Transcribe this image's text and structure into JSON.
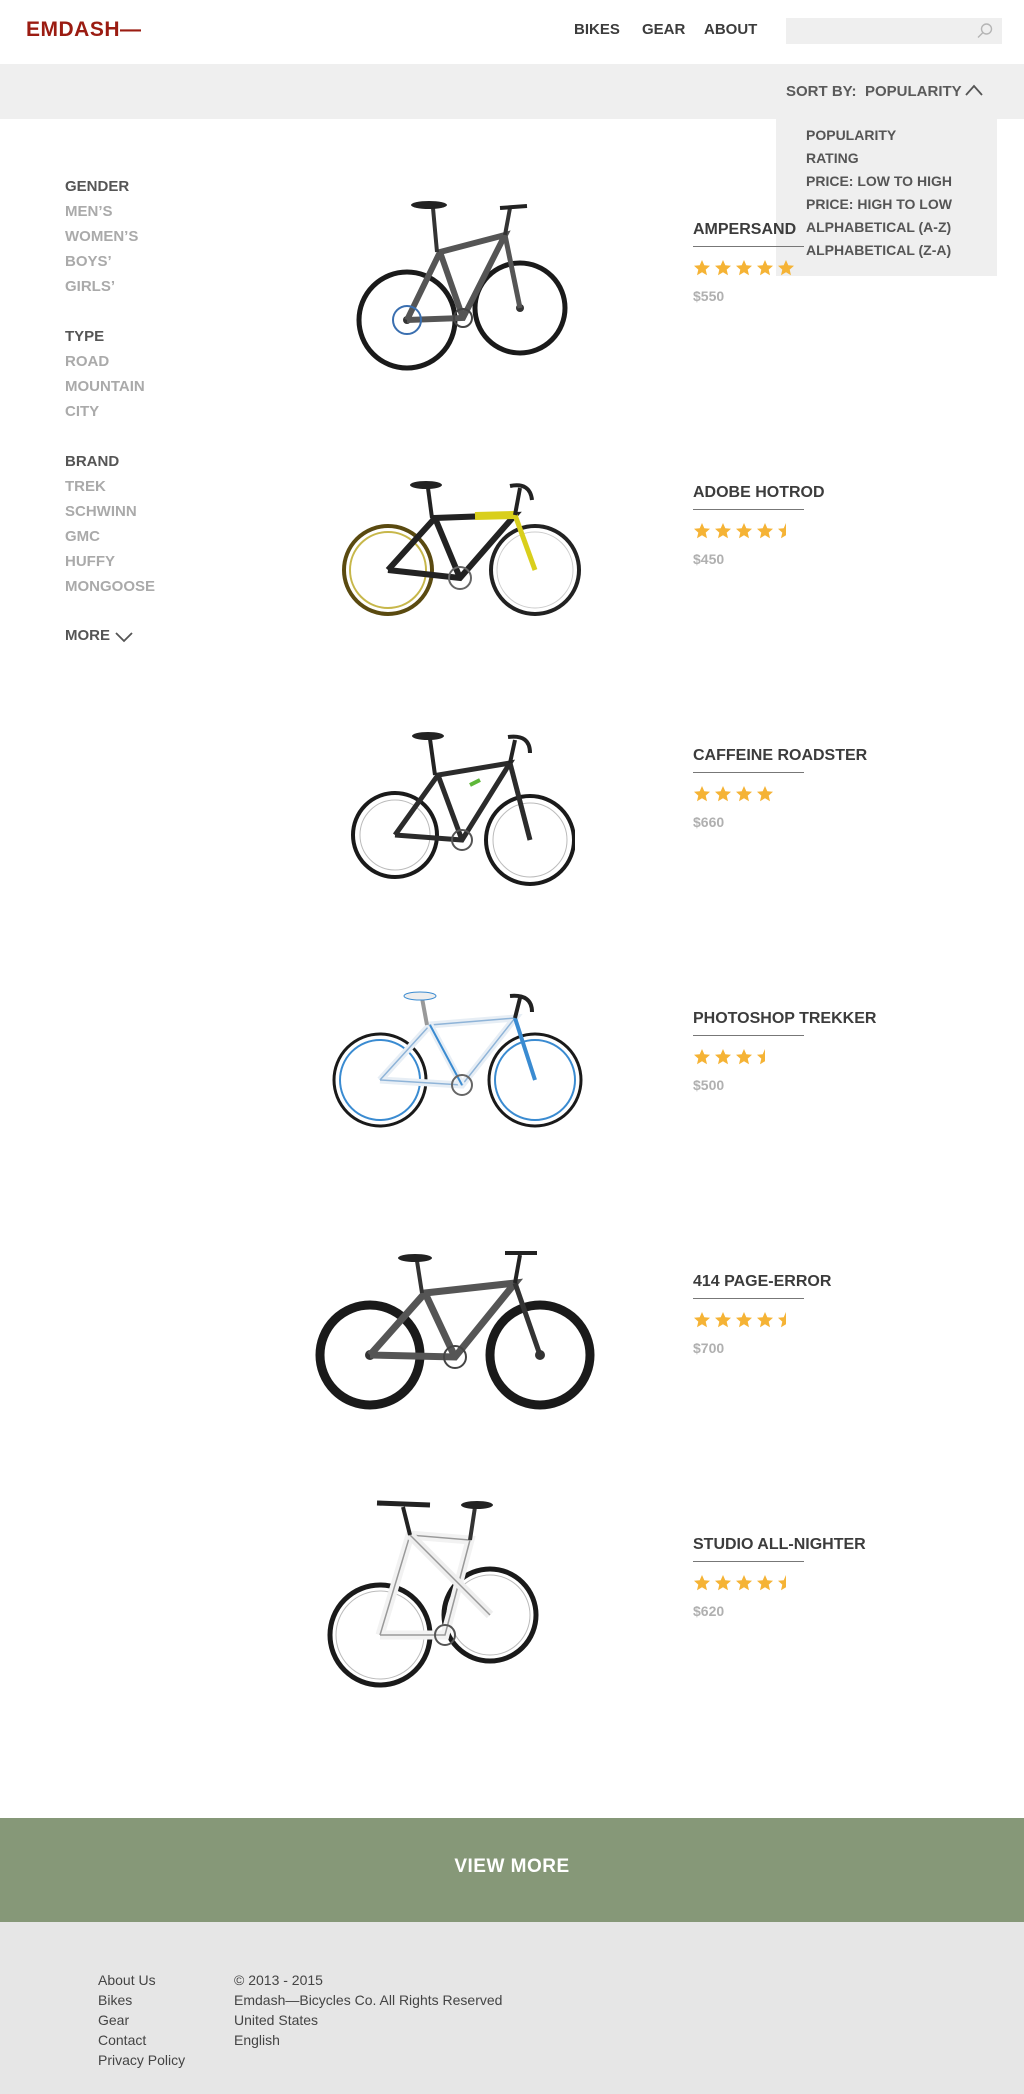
{
  "header": {
    "logo": "EMDASH—",
    "nav": [
      "BIKES",
      "GEAR",
      "ABOUT"
    ],
    "search_placeholder": ""
  },
  "sort": {
    "label": "SORT BY:",
    "value": "POPULARITY",
    "options": [
      "POPULARITY",
      "RATING",
      "PRICE: LOW TO HIGH",
      "PRICE: HIGH TO LOW",
      "ALPHABETICAL (A-Z)",
      "ALPHABETICAL (Z-A)"
    ]
  },
  "filters": {
    "gender": {
      "title": "GENDER",
      "items": [
        "MEN’S",
        "WOMEN’S",
        "BOYS’",
        "GIRLS’"
      ]
    },
    "type": {
      "title": "TYPE",
      "items": [
        "ROAD",
        "MOUNTAIN",
        "CITY"
      ]
    },
    "brand": {
      "title": "BRAND",
      "items": [
        "TREK",
        "SCHWINN",
        "GMC",
        "HUFFY",
        "MONGOOSE"
      ]
    },
    "more_label": "MORE"
  },
  "products": [
    {
      "name": "AMPERSAND",
      "rating": 5,
      "price": "$550"
    },
    {
      "name": "ADOBE HOTROD",
      "rating": 4.5,
      "price": "$450"
    },
    {
      "name": "CAFFEINE ROADSTER",
      "rating": 4,
      "price": "$660"
    },
    {
      "name": "PHOTOSHOP TREKKER",
      "rating": 3.5,
      "price": "$500"
    },
    {
      "name": "414 PAGE-ERROR",
      "rating": 4.5,
      "price": "$700"
    },
    {
      "name": "STUDIO ALL-NIGHTER",
      "rating": 4.5,
      "price": "$620"
    }
  ],
  "view_more_label": "VIEW MORE",
  "footer": {
    "links": [
      "About Us",
      "Bikes",
      "Gear",
      "Contact",
      "Privacy Policy"
    ],
    "info": [
      "© 2013 - 2015",
      "Emdash—Bicycles Co. All Rights Reserved",
      "United States",
      "English"
    ]
  },
  "colors": {
    "brand": "#9b1c12",
    "star": "#f5b335",
    "view_more_bg": "#869878",
    "footer_bg": "#e6e6e6",
    "sort_bg": "#efefef"
  },
  "icons": {
    "search": "search-icon",
    "sort_toggle": "chevron-up-icon",
    "more_toggle": "chevron-down-icon",
    "rating": "star-icon"
  }
}
